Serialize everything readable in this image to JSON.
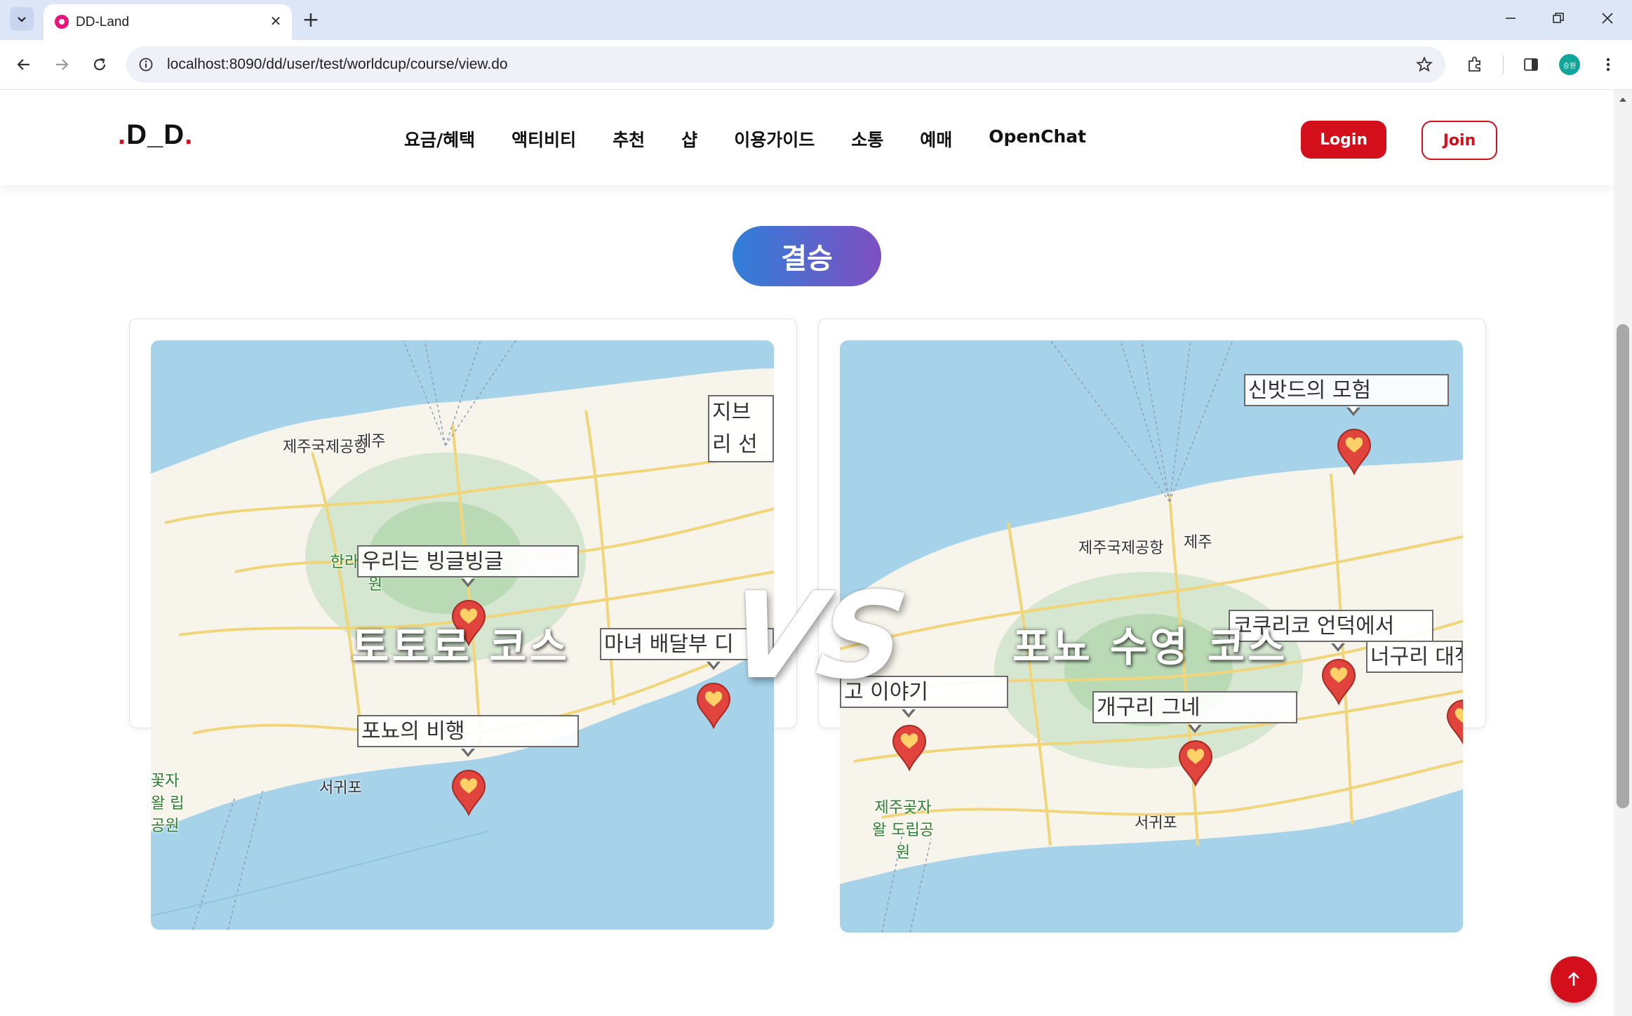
{
  "browser": {
    "tab_title": "DD-Land",
    "url": "localhost:8090/dd/user/test/worldcup/course/view.do",
    "profile_initials": "승원"
  },
  "site": {
    "logo_text": "D_D",
    "nav": [
      "요금/혜택",
      "액티비티",
      "추천",
      "샵",
      "이용가이드",
      "소통",
      "예매",
      "OpenChat"
    ],
    "login_label": "Login",
    "join_label": "Join",
    "brand_color": "#d20f1a"
  },
  "round": {
    "label": "결승"
  },
  "vs_text": "VS",
  "left_course": {
    "title": "토토로 코스",
    "spots": [
      {
        "name": "우리는 빙글빙글"
      },
      {
        "name": "포뇨의 비행"
      },
      {
        "name": "마녀 배달부 디"
      },
      {
        "name": "지브리 선"
      }
    ],
    "places": [
      "제주국제공항",
      "제주",
      "한라산 국립공원",
      "서귀포",
      "꽃자왈 립공원"
    ]
  },
  "right_course": {
    "title": "포뇨 수영 코스",
    "spots": [
      {
        "name": "신밧드의 모험"
      },
      {
        "name": "코쿠리코 언덕에서"
      },
      {
        "name": "너구리 대작"
      },
      {
        "name": "개구리 그네"
      },
      {
        "name": "고 이야기"
      }
    ],
    "places": [
      "제주국제공항",
      "제주",
      "서귀포",
      "제주곶자왈 도립공원"
    ]
  }
}
